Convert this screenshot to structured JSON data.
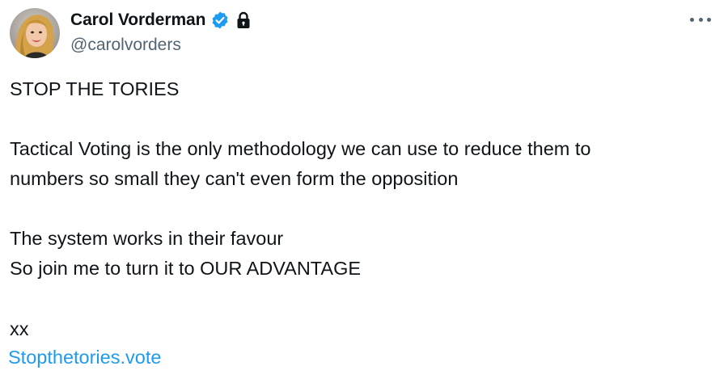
{
  "author": {
    "display_name": "Carol Vorderman",
    "handle": "@carolvorders",
    "avatar_icon": "profile-photo",
    "verified_icon": "verified-badge-icon",
    "protected_icon": "lock-icon"
  },
  "menu": {
    "more_icon": "more-options-icon"
  },
  "tweet": {
    "lines": [
      "STOP THE TORIES",
      "Tactical Voting is the only methodology we can use to reduce them to",
      "numbers so small they can't even form the opposition",
      "The system works in their favour",
      "So join me to turn it to OUR ADVANTAGE",
      "xx"
    ],
    "link_text": "Stopthetories.vote"
  },
  "colors": {
    "text": "#0f1419",
    "secondary": "#536471",
    "accent": "#1d9bf0"
  }
}
